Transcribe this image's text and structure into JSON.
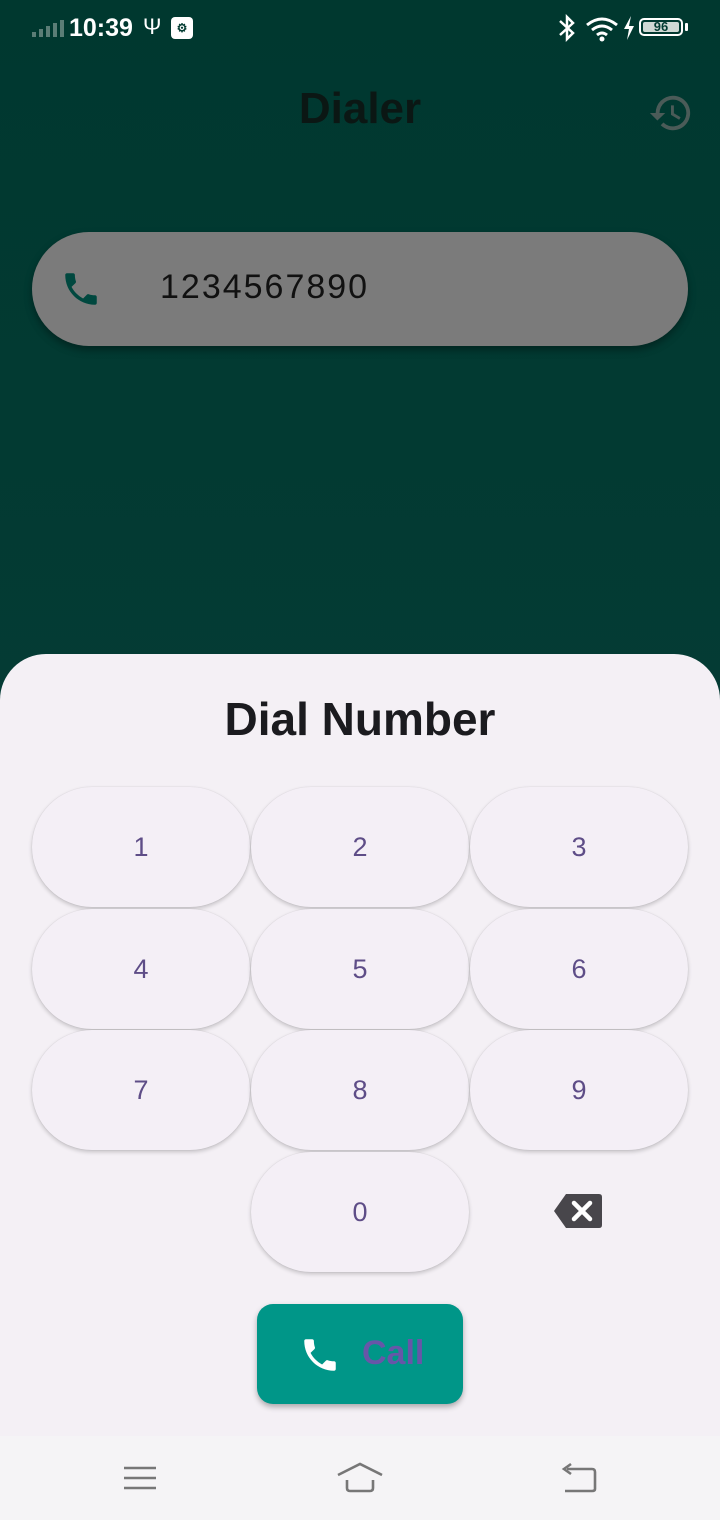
{
  "status": {
    "time": "10:39",
    "battery": "96",
    "icons": [
      "signal-icon",
      "usb-icon",
      "notification-badge-icon",
      "bluetooth-icon",
      "wifi-icon",
      "charging-icon",
      "battery-icon"
    ]
  },
  "app_bar": {
    "title": "Dialer",
    "history_icon": "history-icon"
  },
  "number_field": {
    "value": "1234567890",
    "icon": "phone-icon"
  },
  "sheet": {
    "title": "Dial Number",
    "keys": [
      "1",
      "2",
      "3",
      "4",
      "5",
      "6",
      "7",
      "8",
      "9",
      "0"
    ],
    "backspace_icon": "backspace-icon",
    "call_label": "Call"
  },
  "nav": {
    "icons": [
      "menu-icon",
      "home-icon",
      "back-icon"
    ]
  },
  "colors": {
    "accent": "#009688",
    "background": "#003a30",
    "sheet": "#f4f0f5",
    "key_text": "#5e4d87"
  }
}
